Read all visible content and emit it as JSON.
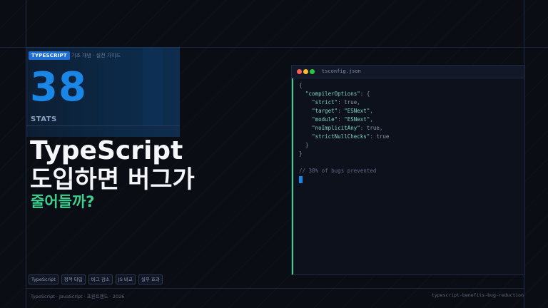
{
  "stats": {
    "badge": "TYPESCRIPT",
    "separator": "/",
    "breadcrumb": "기초 개념 · 실전 가이드",
    "number": "38",
    "label": "STATS"
  },
  "headline": {
    "line1": "TypeScript",
    "line2": "도입하면 버그가",
    "line3": "줄어들까?"
  },
  "tags": [
    "TypeScript",
    "정적 타입",
    "버그 감소",
    "JS 비교",
    "실무 효과"
  ],
  "footer": {
    "left": "TypeScript · JavaScript · 프론트엔드 · 2026",
    "right": "typescript-benefits-bug-reduction"
  },
  "editor": {
    "filename": "tsconfig.json",
    "lines": [
      {
        "indent": "",
        "parts": [
          {
            "t": "{",
            "c": "punc"
          }
        ]
      },
      {
        "indent": "  ",
        "parts": [
          {
            "t": "\"compilerOptions\"",
            "c": "key"
          },
          {
            "t": ": {",
            "c": "punc"
          }
        ]
      },
      {
        "indent": "    ",
        "parts": [
          {
            "t": "\"strict\"",
            "c": "key"
          },
          {
            "t": ": true,",
            "c": "punc"
          }
        ]
      },
      {
        "indent": "    ",
        "parts": [
          {
            "t": "\"target\"",
            "c": "key"
          },
          {
            "t": ": ",
            "c": "punc"
          },
          {
            "t": "\"ESNext\"",
            "c": "str"
          },
          {
            "t": ",",
            "c": "punc"
          }
        ]
      },
      {
        "indent": "    ",
        "parts": [
          {
            "t": "\"module\"",
            "c": "key"
          },
          {
            "t": ": ",
            "c": "punc"
          },
          {
            "t": "\"ESNext\"",
            "c": "str"
          },
          {
            "t": ",",
            "c": "punc"
          }
        ]
      },
      {
        "indent": "    ",
        "parts": [
          {
            "t": "\"noImplicitAny\"",
            "c": "key"
          },
          {
            "t": ": true,",
            "c": "punc"
          }
        ]
      },
      {
        "indent": "    ",
        "parts": [
          {
            "t": "\"strictNullChecks\"",
            "c": "key"
          },
          {
            "t": ": true",
            "c": "punc"
          }
        ]
      },
      {
        "indent": "  ",
        "parts": [
          {
            "t": "}",
            "c": "punc"
          }
        ]
      },
      {
        "indent": "",
        "parts": [
          {
            "t": "}",
            "c": "punc"
          }
        ]
      },
      {
        "indent": "",
        "parts": [
          {
            "t": "",
            "c": "punc"
          }
        ]
      },
      {
        "indent": "",
        "parts": [
          {
            "t": "// 38% of bugs prevented",
            "c": "cmt"
          }
        ]
      }
    ]
  },
  "colors": {
    "accent": "#1a87e6",
    "green": "#3ecf8e",
    "background": "#0b0d14"
  }
}
